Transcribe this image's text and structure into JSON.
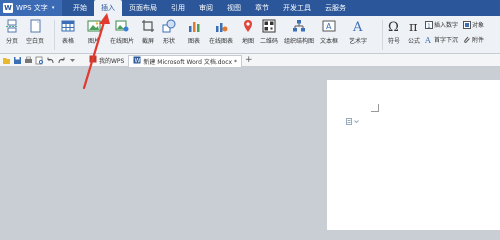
{
  "app": {
    "name": "WPS 文字",
    "logo": "W",
    "caret": "▾"
  },
  "menu_tabs": [
    "开始",
    "插入",
    "页面布局",
    "引用",
    "审阅",
    "视图",
    "章节",
    "开发工具",
    "云服务"
  ],
  "active_tab": "插入",
  "ribbon": {
    "page_break": "分页",
    "blank_page": "空白页",
    "table": "表格",
    "picture": "图片",
    "online_picture": "在线图片",
    "screenshot": "截屏",
    "shapes": "形状",
    "chart": "图表",
    "online_chart": "在线图表",
    "map": "地图",
    "qrcode": "二维码",
    "org_chart": "组织结构图",
    "textbox": "文本框",
    "wordart": "艺术字",
    "symbol": "符号",
    "formula": "公式",
    "insert_number": "插入数字",
    "object": "对象",
    "drop_cap": "首字下沉",
    "attachment": "附件"
  },
  "doc_tabs": [
    "我的WPS",
    "新建 Microsoft Word 文档.docx *"
  ],
  "new_tab": "+",
  "colors": {
    "menubar": "#2b579a",
    "ribbon": "#eef1f6",
    "workspace": "#c9cdd4",
    "arrow": "#e23a2e"
  }
}
